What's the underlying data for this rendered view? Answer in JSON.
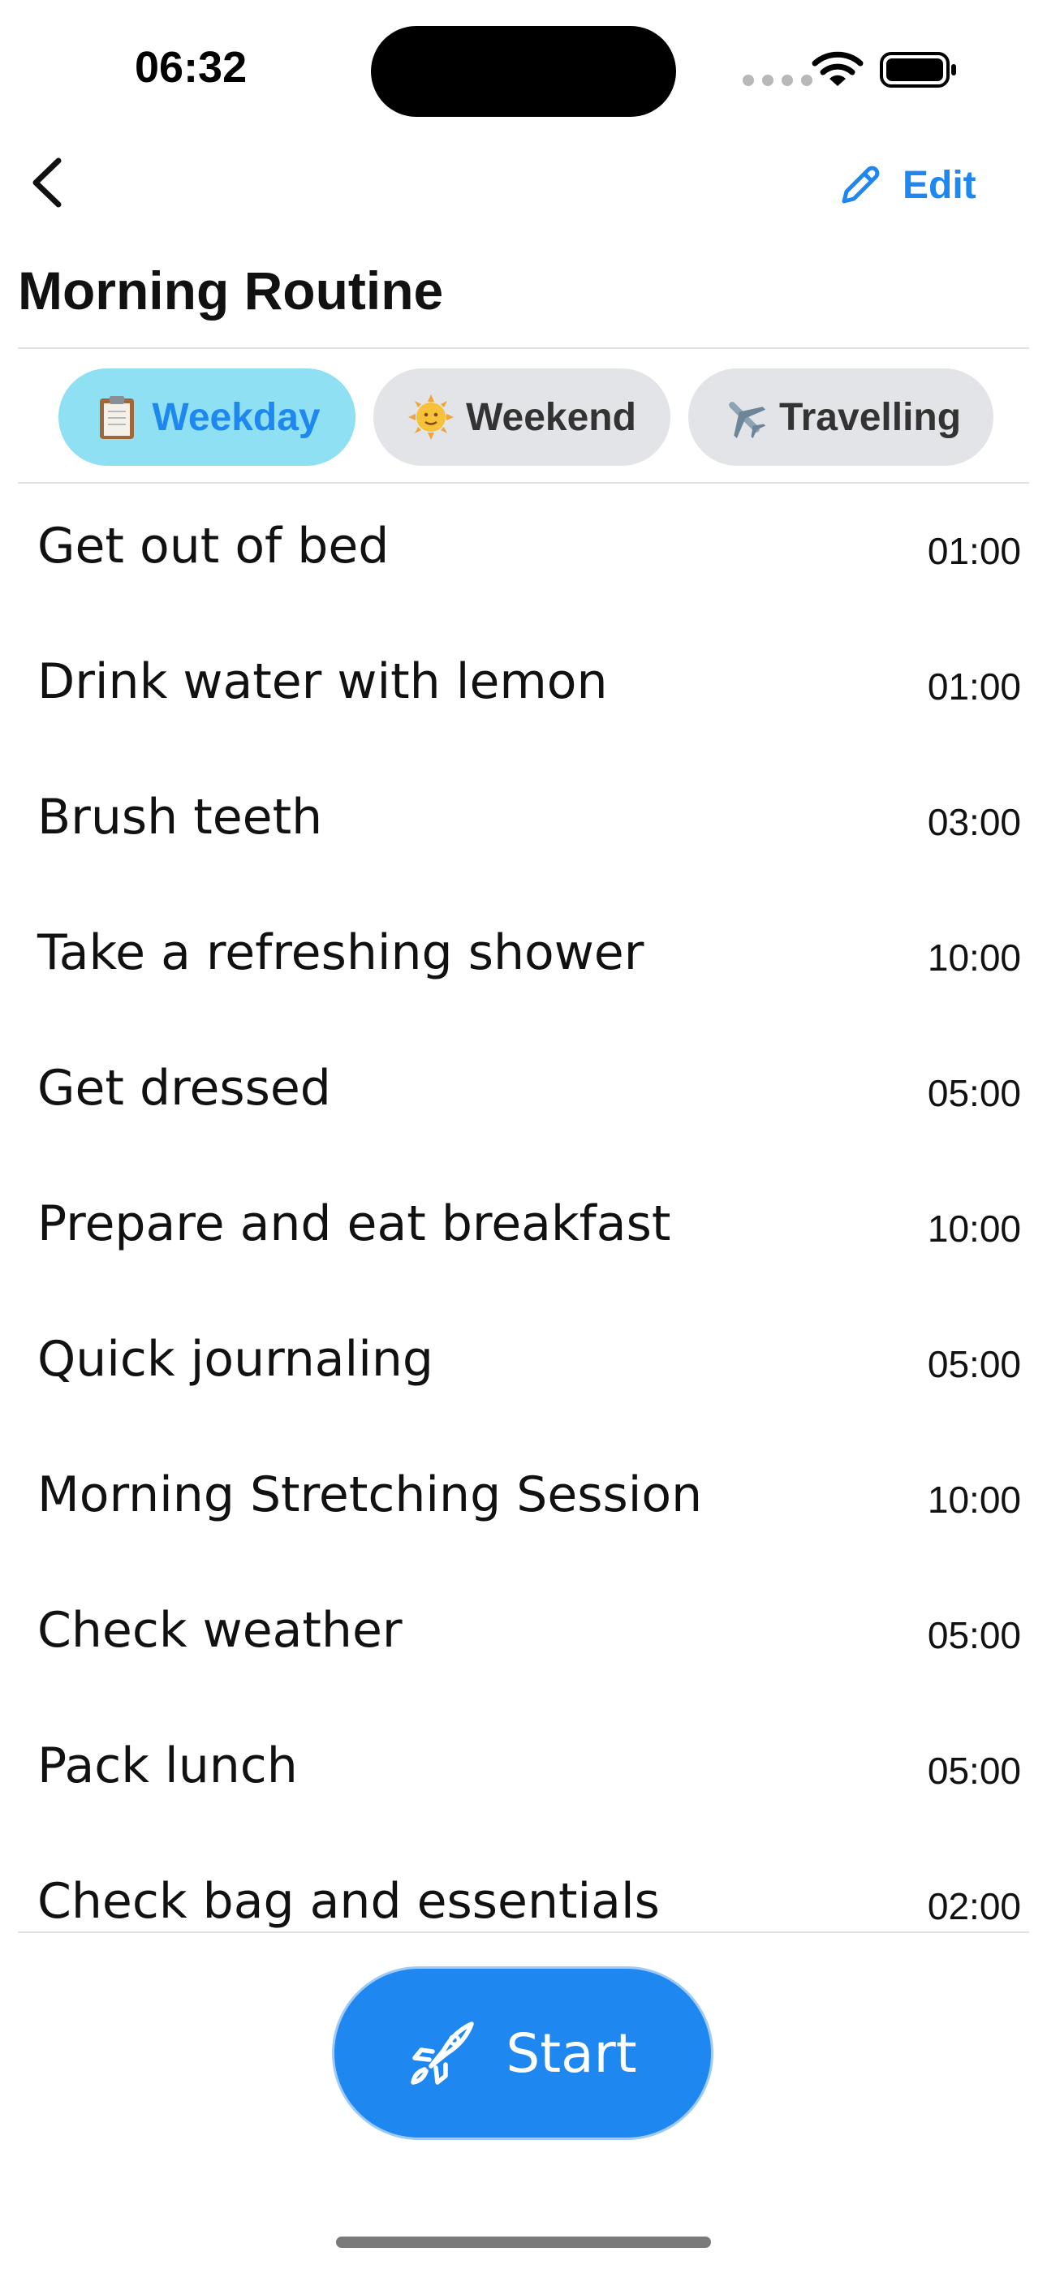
{
  "status_bar": {
    "time": "06:32"
  },
  "nav": {
    "edit_label": "Edit",
    "accent_color": "#1e88f0"
  },
  "page": {
    "title": "Morning Routine"
  },
  "tabs": [
    {
      "label": "Weekday",
      "icon": "clipboard-icon",
      "active": true
    },
    {
      "label": "Weekend",
      "icon": "sun-face-icon",
      "active": false
    },
    {
      "label": "Travelling",
      "icon": "airplane-icon",
      "active": false
    }
  ],
  "tasks": [
    {
      "name": "Get out of bed",
      "duration": "01:00"
    },
    {
      "name": "Drink water with lemon",
      "duration": "01:00"
    },
    {
      "name": "Brush teeth",
      "duration": "03:00"
    },
    {
      "name": "Take a refreshing shower",
      "duration": "10:00"
    },
    {
      "name": "Get dressed",
      "duration": "05:00"
    },
    {
      "name": "Prepare and eat breakfast",
      "duration": "10:00"
    },
    {
      "name": "Quick journaling",
      "duration": "05:00"
    },
    {
      "name": "Morning Stretching Session",
      "duration": "10:00"
    },
    {
      "name": "Check weather",
      "duration": "05:00"
    },
    {
      "name": "Pack lunch",
      "duration": "05:00"
    },
    {
      "name": "Check bag and essentials",
      "duration": "02:00"
    }
  ],
  "start_button": {
    "label": "Start",
    "icon": "rocket-icon"
  }
}
